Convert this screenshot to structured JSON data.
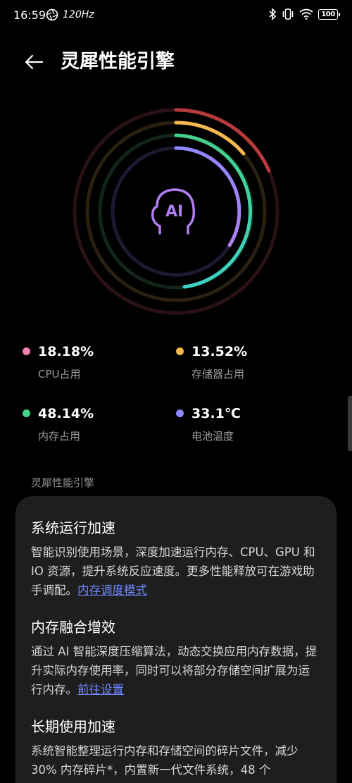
{
  "status_bar": {
    "time": "16:59",
    "refresh": "120Hz",
    "battery": "100"
  },
  "header": {
    "title": "灵犀性能引擎"
  },
  "rings": {
    "center_icon": "ai-head-icon",
    "center_text": "AI"
  },
  "metrics": [
    {
      "value": "18.18%",
      "label": "CPU占用",
      "color": "#f081b0"
    },
    {
      "value": "13.52%",
      "label": "存储器占用",
      "color": "#f5b94e"
    },
    {
      "value": "48.14%",
      "label": "内存占用",
      "color": "#45d18a"
    },
    {
      "value": "33.1℃",
      "label": "电池温度",
      "color": "#8f87ff"
    }
  ],
  "section_label": "灵犀性能引擎",
  "features": [
    {
      "title": "系统运行加速",
      "desc": "智能识别使用场景，深度加速运行内存、CPU、GPU 和 IO 资源，提升系统反应速度。更多性能释放可在游戏助手调配。",
      "link": "内存调度模式"
    },
    {
      "title": "内存融合增效",
      "desc": "通过 AI 智能深度压缩算法，动态交换应用内存数据，提升实际内存使用率，同时可以将部分存储空间扩展为运行内存。",
      "link": "前往设置"
    },
    {
      "title": "长期使用加速",
      "desc": "系统智能整理运行内存和存储空间的碎片文件，减少 30% 内存碎片*，内置新一代文件系统，48 个",
      "link": ""
    }
  ],
  "colors": {
    "ring_red": "#b83a3a",
    "ring_yellow": "#f5b94e",
    "ring_green": "#45d18a",
    "ring_purple": "#a37df5",
    "ring_cyan": "#3ed2d6",
    "link": "#6f87ff"
  }
}
